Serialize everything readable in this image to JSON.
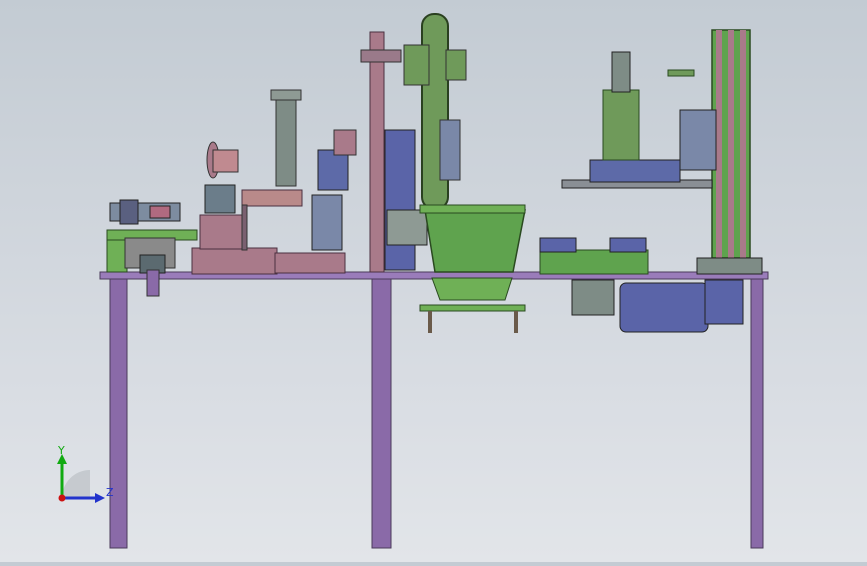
{
  "viewport": {
    "background_top": "#c3cbd3",
    "background_bottom": "#e2e5e9"
  },
  "colors": {
    "table_frame": "#8a6aa8",
    "table_top": "#9a7cba",
    "machine_pink": "#a97a8a",
    "machine_green": "#5fa34e",
    "machine_olive": "#6f9a5a",
    "machine_blue": "#5a64a8",
    "machine_gray": "#7e8c86",
    "axis_y": "#11aa11",
    "axis_z": "#2233cc",
    "axis_origin": "#cc1111"
  },
  "triad": {
    "y_label": "Y",
    "z_label": "Z"
  },
  "model": {
    "assembly_icon": "machine-assembly-icon"
  }
}
